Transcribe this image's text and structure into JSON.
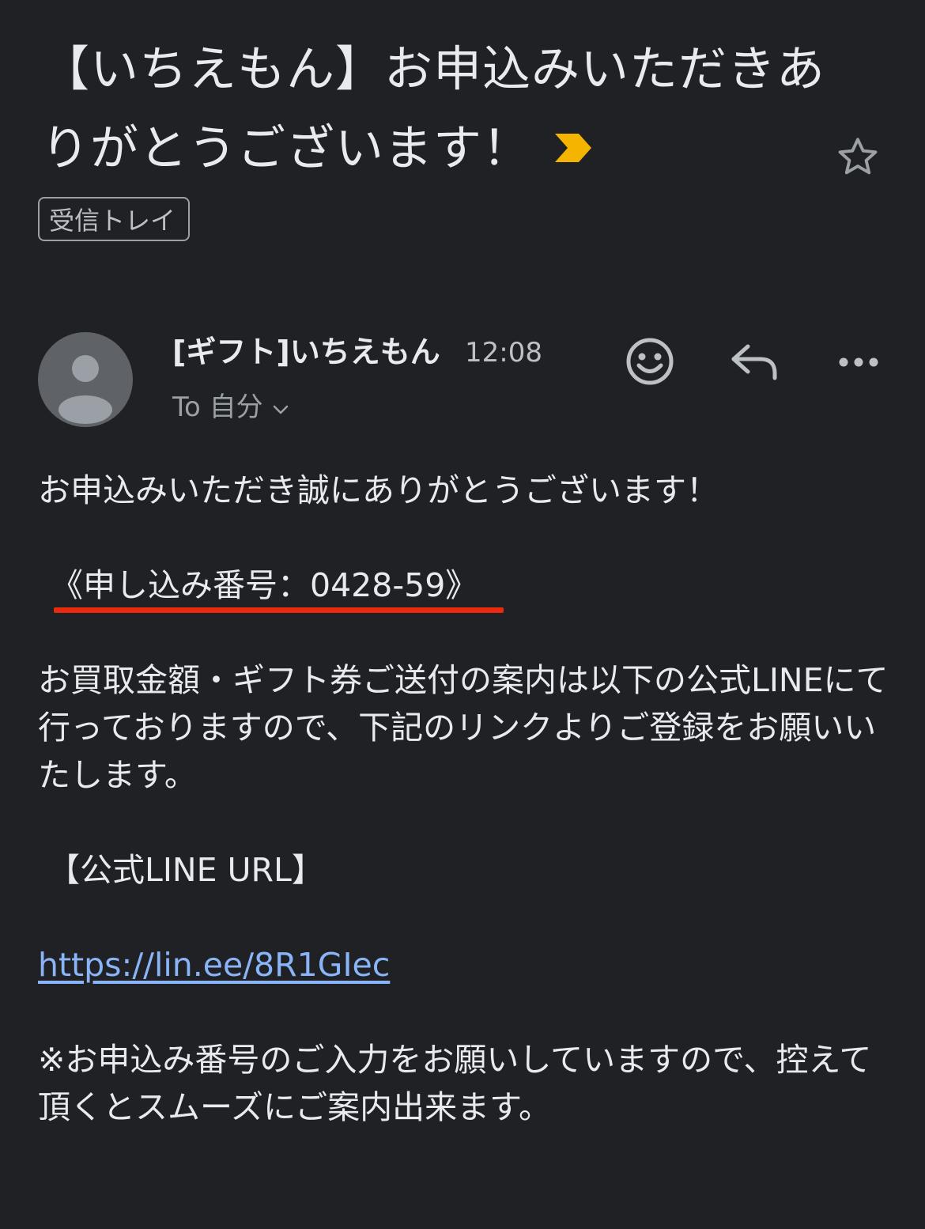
{
  "email": {
    "subject": "【いちえもん】お申込みいただきありがとうございます！",
    "label": "受信トレイ",
    "sender": "[ギフト]いちえもん",
    "time": "12:08",
    "recipient": "To 自分"
  },
  "body": {
    "line1": "お申込みいただき誠にありがとうございます！",
    "application_number": "《申し込み番号：0428-59》",
    "paragraph2": "お買取金額・ギフト券ご送付の案内は以下の公式LINEにて行っておりますので、下記のリンクよりご登録をお願いいたします。",
    "official_line_heading": "【公式LINE URL】",
    "link": "https://lin.ee/8R1GIec",
    "paragraph3": "※お申込み番号のご入力をお願いしていますので、控えて頂くとスムーズにご案内出来ます。"
  },
  "colors": {
    "background": "#202124",
    "importance_marker": "#f4b400",
    "link": "#8ab4f8",
    "underline_highlight": "#ea2a0c"
  },
  "icons": {
    "importance": "importance-marker-icon",
    "star": "star-outline-icon",
    "avatar": "person-icon",
    "emoji": "smiley-icon",
    "reply": "reply-icon",
    "more": "more-horizontal-icon",
    "expand": "chevron-down-icon"
  }
}
